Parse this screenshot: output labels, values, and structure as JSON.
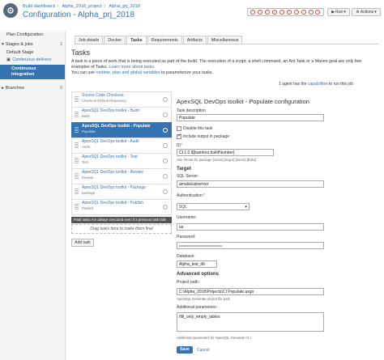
{
  "header": {
    "breadcrumbs": [
      "Build dashboard",
      "Alpha_2018_project",
      "Alpha_prj_2018"
    ],
    "separator": "/",
    "title": "Configuration - Alpha_prj_2018",
    "run_label": "Run",
    "actions_label": "Actions"
  },
  "sidebar": {
    "plan_configuration": "Plan Configuration",
    "stages_jobs": "Stages & jobs",
    "stages_count": "2",
    "default_stage": "Default Stage",
    "continuous_delivery": "Continuous delivery",
    "continuous_integration_1": "Continuous",
    "continuous_integration_2": "integration",
    "branches": "Branches",
    "branches_count": "0"
  },
  "tabs": [
    "Job details",
    "Docker",
    "Tasks",
    "Requirements",
    "Artifacts",
    "Miscellaneous"
  ],
  "active_tab": "Tasks",
  "tasks_section": {
    "heading": "Tasks",
    "description_1": "A task is a piece of work that is being executed as part of the build. The execution of a script, a shell command, an Ant Task or a Maven goal are only few",
    "description_2_pre": "examples of Tasks. ",
    "description_2_link": "Learn more about tasks.",
    "description_3_pre": "You can use ",
    "description_3_link": "runtime, plan and global variables",
    "description_3_post": " to parameterize your tasks.",
    "agent_pre": "1 agent has the ",
    "agent_link": "capabilities",
    "agent_post": " to run this job"
  },
  "task_list": [
    {
      "name": "Source Code Checkout",
      "sub": "Checkout Default Repository",
      "selected": false
    },
    {
      "name": "ApexSQL DevOps toolkit - Build",
      "sub": "Build",
      "selected": false
    },
    {
      "name": "ApexSQL DevOps toolkit - Populate",
      "sub": "Populate",
      "selected": true
    },
    {
      "name": "ApexSQL DevOps toolkit - Audit",
      "sub": "Audit",
      "selected": false
    },
    {
      "name": "ApexSQL DevOps toolkit - Test",
      "sub": "Test",
      "selected": false
    },
    {
      "name": "ApexSQL DevOps toolkit - Review",
      "sub": "Review",
      "selected": false
    },
    {
      "name": "ApexSQL DevOps toolkit - Package",
      "sub": "package",
      "selected": false
    },
    {
      "name": "ApexSQL DevOps toolkit - Publish",
      "sub": "Publish",
      "selected": false
    }
  ],
  "final_tasks": "Final tasks  Are always executed even if a previous task fails",
  "drag_hint": "Drag tasks here to make them final",
  "add_task": "Add task",
  "form": {
    "title": "ApexSQL DevOps toolkit - Populate configuration",
    "task_description_label": "Task description",
    "task_description_value": "Populate",
    "disable_label": "Disable this task",
    "include_output_label": "Include output in package",
    "id_label": "ID",
    "id_value": "CI.1.0.${bamboo.buildNumber}",
    "id_hint": "Use format for package [name].[major].[minor].[build]",
    "target_heading": "Target",
    "sql_server_label": "SQL Server:",
    "sql_server_value": "amalia\\sqlserver",
    "authentication_label": "Authentication:",
    "authentication_value": "SQL",
    "username_label": "Username:",
    "username_value": "sa",
    "password_label": "Password:",
    "password_value": "••••••••••••••••••••••••••••••••••••••",
    "database_label": "Database:",
    "database_value": "Alpha_test_db",
    "advanced_heading": "Advanced options",
    "project_path_label": "Project path:",
    "project_path_value": "C:\\Alpha_2018\\Projects\\CI Populate.axgn",
    "project_path_hint": "ApexSQL Generate project file path",
    "additional_params_label": "Additional parameters:",
    "additional_params_value": "/fill_only_empty_tables",
    "additional_params_hint": "Additional parameters for ApexSQL Generate CLI",
    "save_label": "Save",
    "cancel_label": "Cancel"
  },
  "colors": {
    "accent": "#3572b0",
    "status_fail": "#d04437"
  }
}
